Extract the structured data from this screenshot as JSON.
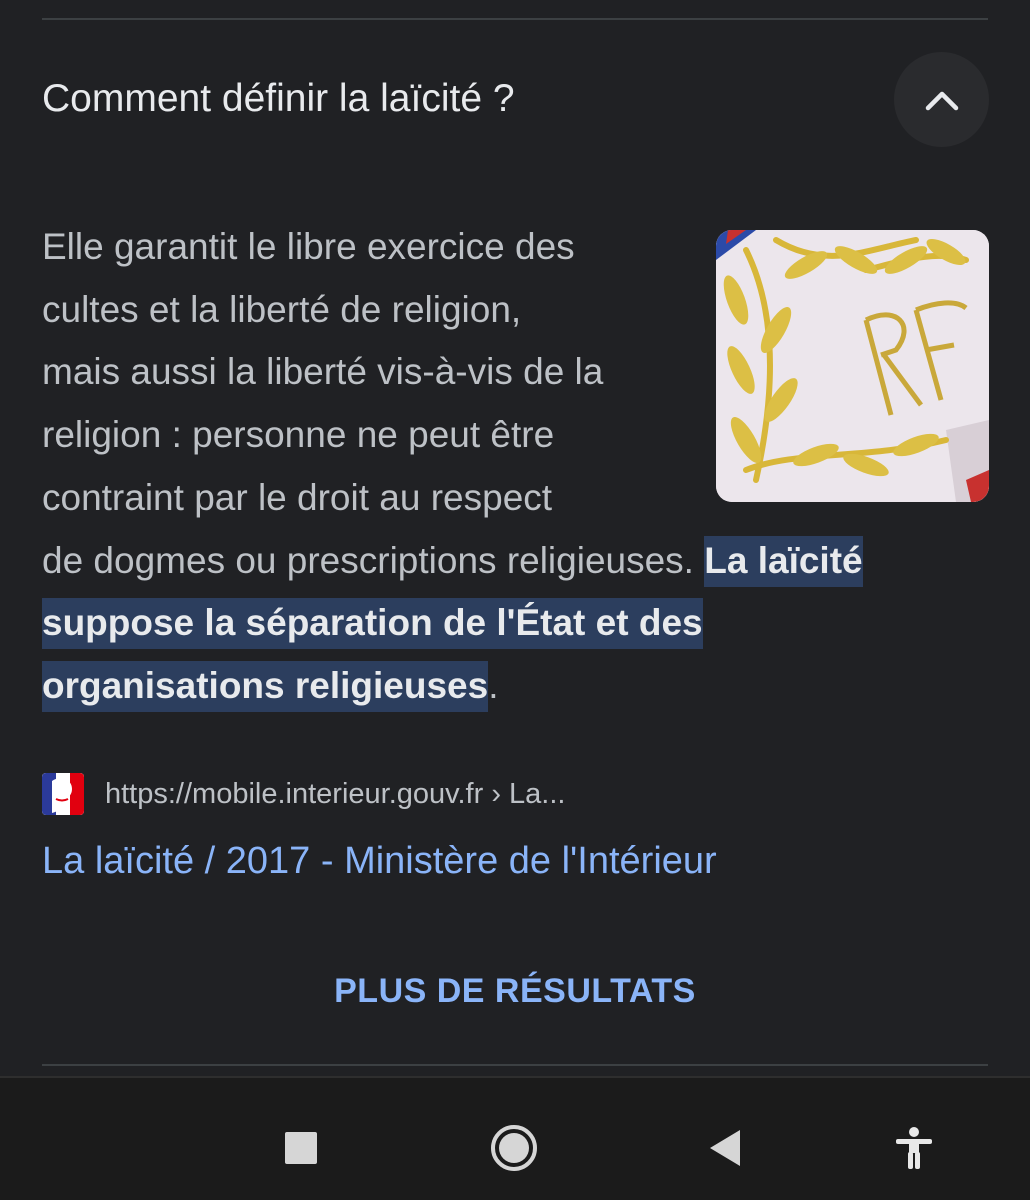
{
  "faq": {
    "question": "Comment définir la laïcité ?",
    "answer": {
      "lines": [
        "Elle garantit le libre exercice des",
        "cultes et la liberté de religion,",
        "mais aussi la liberté vis-à-vis de la",
        "religion : personne ne peut être",
        "contraint par le droit au respect",
        "de dogmes ou prescriptions religieuses. "
      ],
      "highlight_1": "La laïcité",
      "highlight_2": "suppose la séparation de l'État et des",
      "highlight_3": "organisations religieuses",
      "end_punct": "."
    },
    "thumbnail_icon": "embroidered-rf-sash-image",
    "collapse_icon": "chevron-up-icon"
  },
  "source": {
    "favicon": "marianne-logo",
    "url": "https://mobile.interieur.gouv.fr › La...",
    "title": "La laïcité / 2017 - Ministère de l'Intérieur"
  },
  "more_results": "PLUS DE RÉSULTATS",
  "nav": {
    "icons": [
      "recents-icon",
      "home-icon",
      "back-icon",
      "accessibility-icon"
    ]
  },
  "colors": {
    "background": "#202124",
    "link": "#8ab4f8",
    "highlight_bg": "#2c3e5e",
    "body_text": "#bdc1c6"
  }
}
